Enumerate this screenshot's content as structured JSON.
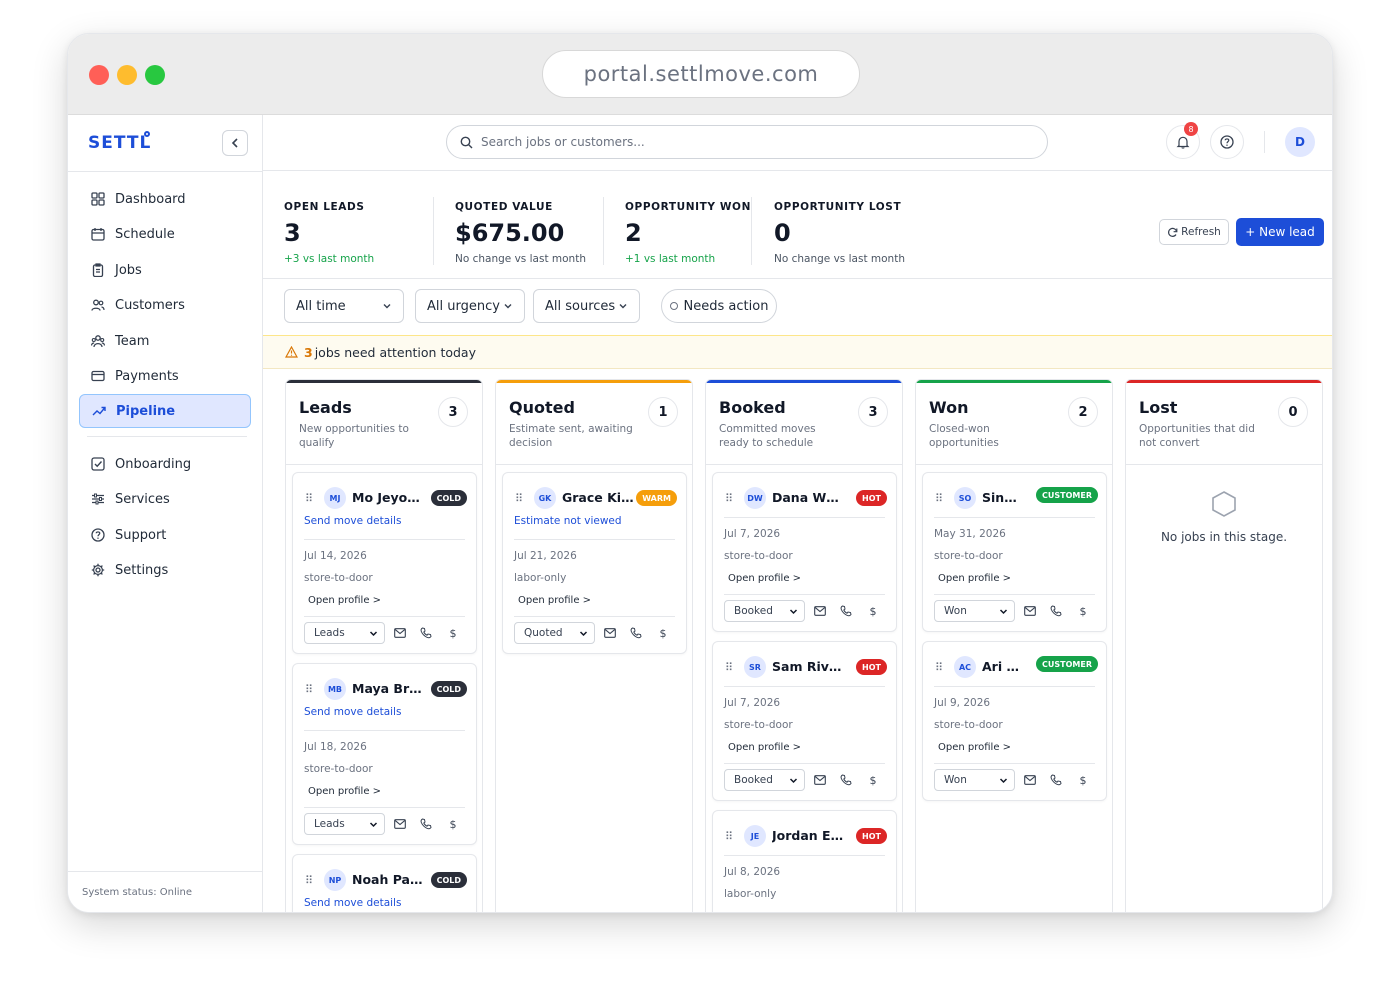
{
  "browser": {
    "url": "portal.settlmove.com"
  },
  "sidebar": {
    "brand": "SETTL",
    "items": [
      {
        "label": "Dashboard",
        "icon": "grid-icon"
      },
      {
        "label": "Schedule",
        "icon": "calendar-icon"
      },
      {
        "label": "Jobs",
        "icon": "clipboard-icon"
      },
      {
        "label": "Customers",
        "icon": "users-icon"
      },
      {
        "label": "Team",
        "icon": "team-icon"
      },
      {
        "label": "Payments",
        "icon": "card-icon"
      },
      {
        "label": "Pipeline",
        "icon": "trend-icon",
        "active": true
      },
      {
        "label": "Onboarding",
        "icon": "checkbox-icon"
      },
      {
        "label": "Services",
        "icon": "sliders-icon"
      },
      {
        "label": "Support",
        "icon": "help-icon"
      },
      {
        "label": "Settings",
        "icon": "gear-icon"
      }
    ],
    "system_status": "System status: Online"
  },
  "header": {
    "search_placeholder": "Search jobs or customers...",
    "notification_count": "8",
    "avatar_initial": "D"
  },
  "stats": [
    {
      "label": "OPEN LEADS",
      "value": "3",
      "sub": "+3 vs last month",
      "trend": "positive"
    },
    {
      "label": "QUOTED VALUE",
      "value": "$675.00",
      "sub": "No change vs last month",
      "trend": "neutral"
    },
    {
      "label": "OPPORTUNITY WON",
      "value": "2",
      "sub": "+1 vs last month",
      "trend": "positive"
    },
    {
      "label": "OPPORTUNITY LOST",
      "value": "0",
      "sub": "No change vs last month",
      "trend": "neutral"
    }
  ],
  "actions": {
    "refresh": "Refresh",
    "new_lead": "+ New lead"
  },
  "filters": {
    "time": "All time",
    "urgency": "All urgency",
    "sources": "All sources",
    "needs_action": "Needs action"
  },
  "alert": {
    "count": "3",
    "text": "jobs need attention today"
  },
  "columns": [
    {
      "title": "Leads",
      "count": "3",
      "description": "New opportunities to qualify",
      "color": "#2b2f3a",
      "cards": [
        {
          "initials": "MJ",
          "name": "Mo Jeyomi",
          "tag": "COLD",
          "link": "Send move details",
          "date": "Jul 14, 2026",
          "type": "store-to-door",
          "profile": "Open profile >",
          "status": "Leads"
        },
        {
          "initials": "MB",
          "name": "Maya Bro...",
          "tag": "COLD",
          "link": "Send move details",
          "date": "Jul 18, 2026",
          "type": "store-to-door",
          "profile": "Open profile >",
          "status": "Leads"
        },
        {
          "initials": "NP",
          "name": "Noah Patel",
          "tag": "COLD",
          "link": "Send move details",
          "date": "",
          "type": "",
          "profile": "",
          "status": ""
        }
      ]
    },
    {
      "title": "Quoted",
      "count": "1",
      "description": "Estimate sent, awaiting decision",
      "color": "#f59e0b",
      "cards": [
        {
          "initials": "GK",
          "name": "Grace Kim",
          "tag": "WARM",
          "link": "Estimate not viewed",
          "date": "Jul 21, 2026",
          "type": "labor-only",
          "profile": "Open profile >",
          "status": "Quoted"
        }
      ]
    },
    {
      "title": "Booked",
      "count": "3",
      "description": "Committed moves ready to schedule",
      "color": "#1d4ed8",
      "cards": [
        {
          "initials": "DW",
          "name": "Dana Whit...",
          "tag": "HOT",
          "link": "",
          "date": "Jul 7, 2026",
          "type": "store-to-door",
          "profile": "Open profile >",
          "status": "Booked"
        },
        {
          "initials": "SR",
          "name": "Sam Rivera",
          "tag": "HOT",
          "link": "",
          "date": "Jul 7, 2026",
          "type": "store-to-door",
          "profile": "Open profile >",
          "status": "Booked"
        },
        {
          "initials": "JE",
          "name": "Jordan Ellis",
          "tag": "HOT",
          "link": "",
          "date": "Jul 8, 2026",
          "type": "labor-only",
          "profile": "",
          "status": ""
        }
      ]
    },
    {
      "title": "Won",
      "count": "2",
      "description": "Closed-won opportunities",
      "color": "#16a34a",
      "cards": [
        {
          "initials": "SO",
          "name": "Sinmi...",
          "tag": "CUSTOMER",
          "link": "",
          "date": "May 31, 2026",
          "type": "store-to-door",
          "profile": "Open profile >",
          "status": "Won"
        },
        {
          "initials": "AC",
          "name": "Ari Ch...",
          "tag": "CUSTOMER",
          "link": "",
          "date": "Jul 9, 2026",
          "type": "store-to-door",
          "profile": "Open profile >",
          "status": "Won"
        }
      ]
    },
    {
      "title": "Lost",
      "count": "0",
      "description": "Opportunities that did not convert",
      "color": "#dc2626",
      "empty_text": "No jobs in this stage."
    }
  ]
}
